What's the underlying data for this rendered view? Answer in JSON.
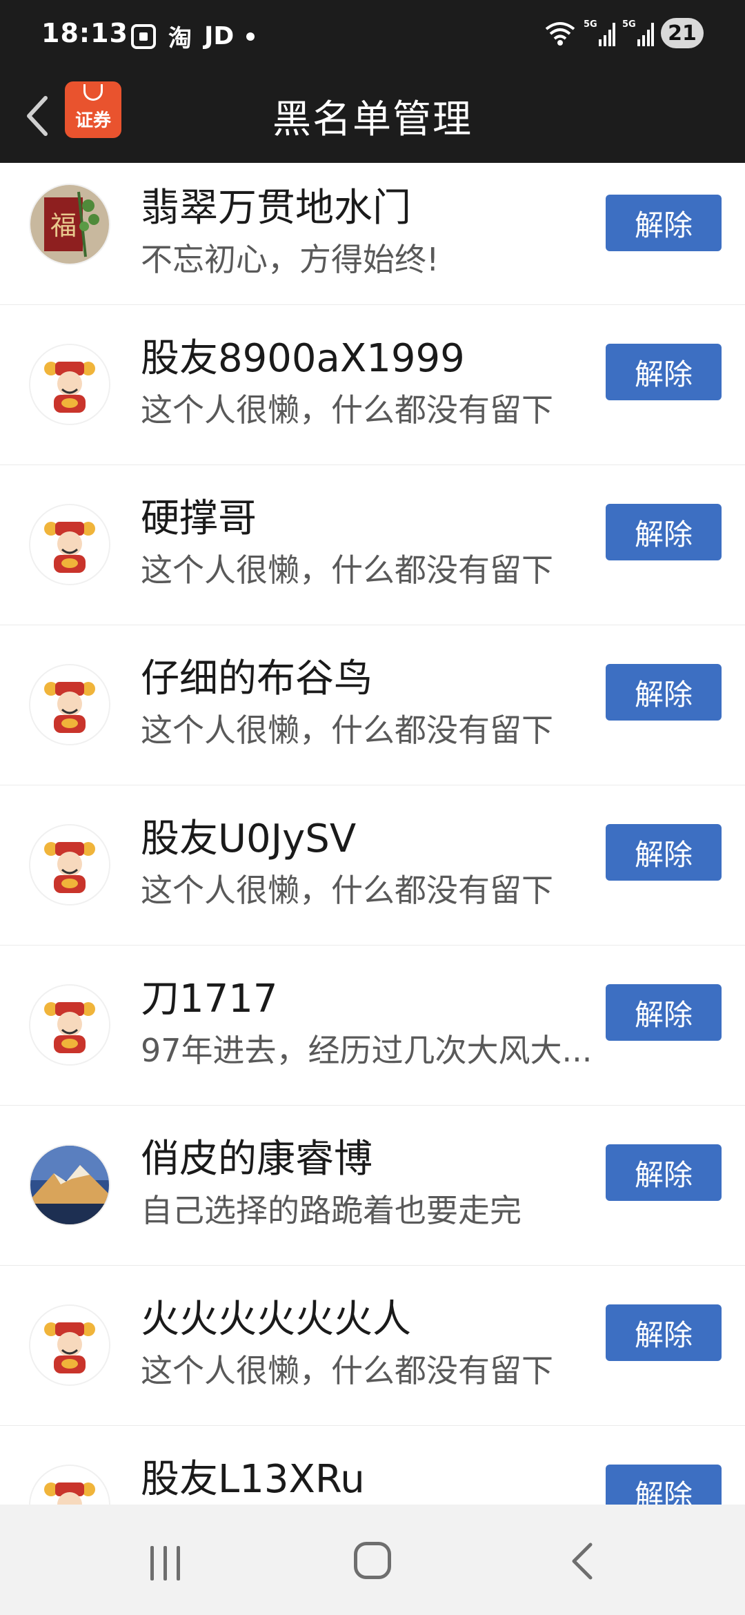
{
  "status_bar": {
    "time": "18:13",
    "left_icons": [
      "scan-icon",
      "taobao-icon",
      "jd-icon",
      "notification-dot-icon"
    ],
    "taobao_glyph": "淘",
    "jd_glyph": "JD",
    "network_label_1": "5G",
    "network_label_2": "5G",
    "battery": "21"
  },
  "header": {
    "title": "黑名单管理",
    "logo_text": "证券"
  },
  "blacklist": {
    "unblock_label": "解除",
    "items": [
      {
        "name": "翡翠万贯地水门",
        "signature": "不忘初心，方得始终!",
        "avatar": "fu-calligraphy-photo"
      },
      {
        "name": "股友8900aX1999",
        "signature": "这个人很懒，什么都没有留下",
        "avatar": "wealth-god-cartoon"
      },
      {
        "name": "硬撑哥",
        "signature": "这个人很懒，什么都没有留下",
        "avatar": "wealth-god-cartoon"
      },
      {
        "name": "仔细的布谷鸟",
        "signature": "这个人很懒，什么都没有留下",
        "avatar": "wealth-god-cartoon"
      },
      {
        "name": "股友U0JySV",
        "signature": "这个人很懒，什么都没有留下",
        "avatar": "wealth-god-cartoon"
      },
      {
        "name": "刀1717",
        "signature": "97年进去，经历过几次大风大...",
        "avatar": "wealth-god-cartoon"
      },
      {
        "name": "俏皮的康睿博",
        "signature": "自己选择的路跪着也要走完",
        "avatar": "snow-mountain-photo"
      },
      {
        "name": "火火火火火火人",
        "signature": "这个人很懒，什么都没有留下",
        "avatar": "wealth-god-cartoon"
      },
      {
        "name": "股友L13XRu",
        "signature": "",
        "avatar": "wealth-god-cartoon"
      }
    ]
  },
  "colors": {
    "bar_background": "#1c1c1c",
    "unblock_button": "#3d6fc2",
    "logo_orange": "#e9532e",
    "nav_background": "#f2f2f2"
  }
}
